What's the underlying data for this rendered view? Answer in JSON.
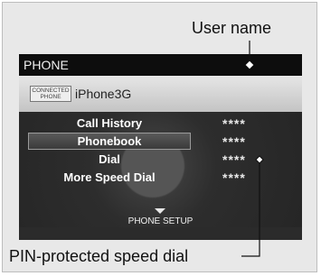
{
  "callouts": {
    "user_name": "User name",
    "pin_speed_dial": "PIN-protected speed dial"
  },
  "screen": {
    "title": "PHONE",
    "connection_badge": [
      "CONNECTED",
      "PHONE"
    ],
    "device_name": "iPhone3G",
    "menu": [
      {
        "label": "Call History",
        "pin": "****",
        "selected": false
      },
      {
        "label": "Phonebook",
        "pin": "****",
        "selected": true
      },
      {
        "label": "Dial",
        "pin": "****",
        "selected": false
      },
      {
        "label": "More Speed Dial",
        "pin": "****",
        "selected": false
      }
    ],
    "footer_label": "PHONE SETUP"
  },
  "colors": {
    "screen_background": "#2b2b2b",
    "title_bar": "#0d0d0d",
    "connection_bar": "#d6d6d6"
  },
  "icons": {
    "diamond_marker": "diamond-marker-icon",
    "footer_arrow": "chevron-down-icon"
  }
}
